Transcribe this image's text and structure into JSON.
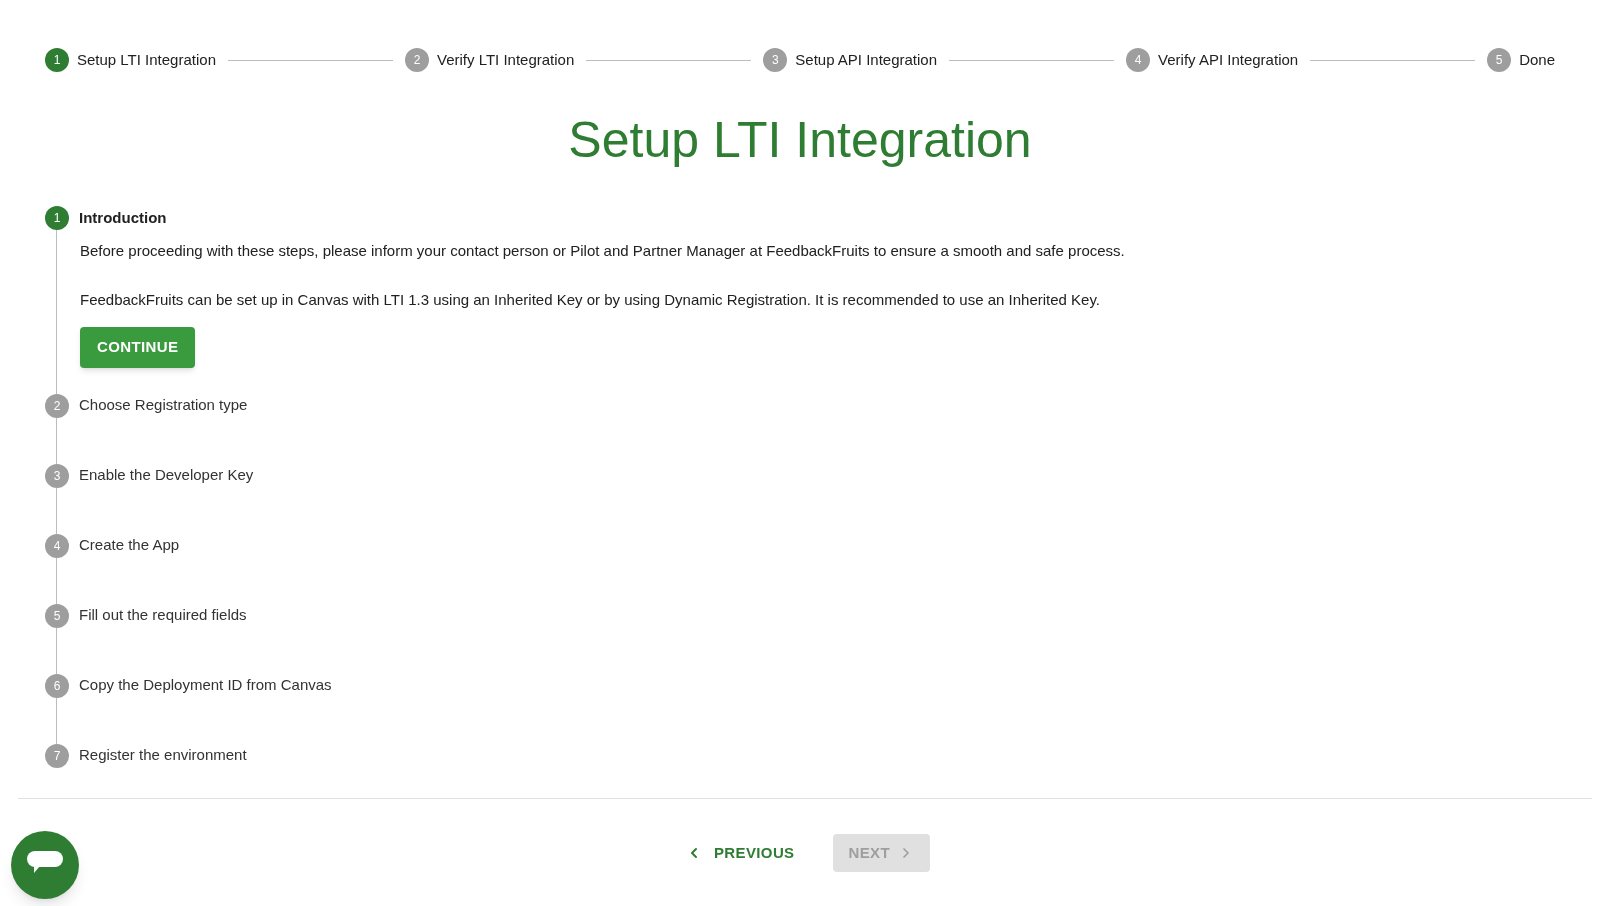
{
  "stepper": [
    {
      "number": "1",
      "label": "Setup LTI Integration",
      "selected": true
    },
    {
      "number": "2",
      "label": "Verify LTI Integration",
      "selected": false
    },
    {
      "number": "3",
      "label": "Setup API Integration",
      "selected": false
    },
    {
      "number": "4",
      "label": "Verify API Integration",
      "selected": false
    },
    {
      "number": "5",
      "label": "Done",
      "selected": false
    }
  ],
  "title": "Setup LTI Integration",
  "steps": [
    {
      "number": "1",
      "label": "Introduction",
      "selected": true,
      "paragraphs": [
        "Before proceeding with these steps, please inform your contact person or Pilot and Partner Manager at FeedbackFruits to ensure a smooth and safe process.",
        "FeedbackFruits can be set up in Canvas with LTI 1.3 using an Inherited Key or by using Dynamic Registration. It is recommended to use an Inherited Key."
      ],
      "button": "CONTINUE"
    },
    {
      "number": "2",
      "label": "Choose Registration type",
      "selected": false
    },
    {
      "number": "3",
      "label": "Enable the Developer Key",
      "selected": false
    },
    {
      "number": "4",
      "label": "Create the App",
      "selected": false
    },
    {
      "number": "5",
      "label": "Fill out the required fields",
      "selected": false
    },
    {
      "number": "6",
      "label": "Copy the Deployment ID from Canvas",
      "selected": false
    },
    {
      "number": "7",
      "label": "Register the environment",
      "selected": false
    }
  ],
  "footer": {
    "previous": {
      "label": "PREVIOUS",
      "disabled": false
    },
    "next": {
      "label": "NEXT",
      "disabled": true
    }
  }
}
